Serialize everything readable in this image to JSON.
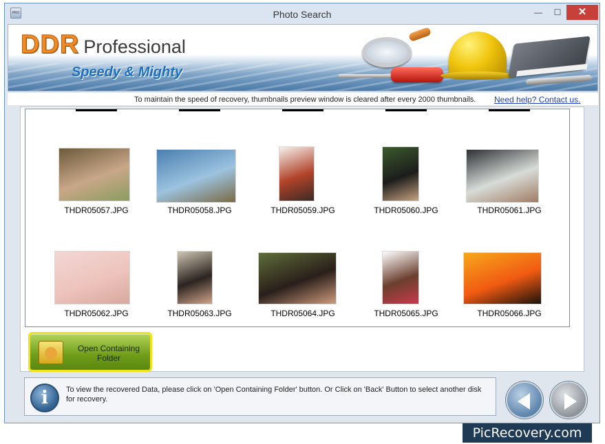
{
  "window": {
    "title": "Photo Search",
    "app_icon_text": "PRO",
    "minimize_glyph": "—",
    "maximize_glyph": "☐",
    "close_glyph": "✕"
  },
  "banner": {
    "brand_ddr": "DDR",
    "brand_professional": "Professional",
    "tagline": "Speedy & Mighty"
  },
  "info_strip": {
    "message": "To maintain the speed of recovery, thumbnails preview window is cleared after every 2000 thumbnails.",
    "help_link": "Need help? Contact us."
  },
  "thumbnails": [
    {
      "label": "THDR05057.JPG",
      "colors": [
        "#6b5a3a",
        "#c9a789",
        "#8a9c5e"
      ]
    },
    {
      "label": "THDR05058.JPG",
      "colors": [
        "#4a7fb1",
        "#9cc3df",
        "#7b6a45"
      ]
    },
    {
      "label": "THDR05059.JPG",
      "colors": [
        "#f5f1ec",
        "#b2432a",
        "#3a2a24"
      ]
    },
    {
      "label": "THDR05060.JPG",
      "colors": [
        "#3b5a2c",
        "#1c1c1c",
        "#c7a27f"
      ]
    },
    {
      "label": "THDR05061.JPG",
      "colors": [
        "#2e3034",
        "#d8dcd8",
        "#a07c63"
      ]
    },
    {
      "label": "THDR05062.JPG",
      "colors": [
        "#f2d6d4",
        "#eec4bd",
        "#d8a89c"
      ]
    },
    {
      "label": "THDR05063.JPG",
      "colors": [
        "#cfc5b3",
        "#2b2420",
        "#d1a48a"
      ]
    },
    {
      "label": "THDR05064.JPG",
      "colors": [
        "#5e6d3a",
        "#2a1f1a",
        "#cf9b7d"
      ]
    },
    {
      "label": "THDR05065.JPG",
      "colors": [
        "#ffffff",
        "#6b3f2e",
        "#c93a4c"
      ]
    },
    {
      "label": "THDR05066.JPG",
      "colors": [
        "#f7a81b",
        "#f15a12",
        "#1a120c"
      ]
    }
  ],
  "scrollbar": {
    "up_glyph": "▲",
    "down_glyph": "▼"
  },
  "open_folder_button": {
    "label": "Open Containing Folder"
  },
  "status": {
    "icon_glyph": "i",
    "message": "To view the recovered Data, please click on 'Open Containing Folder' button. Or Click on 'Back' Button to select another disk for recovery."
  },
  "watermark": "PicRecovery.com",
  "colors": {
    "brand_orange": "#f08a24",
    "tagline_blue": "#1b6fc4",
    "button_green": "#6e9d19",
    "button_border": "#f1e21a",
    "close_red": "#c7403a"
  }
}
